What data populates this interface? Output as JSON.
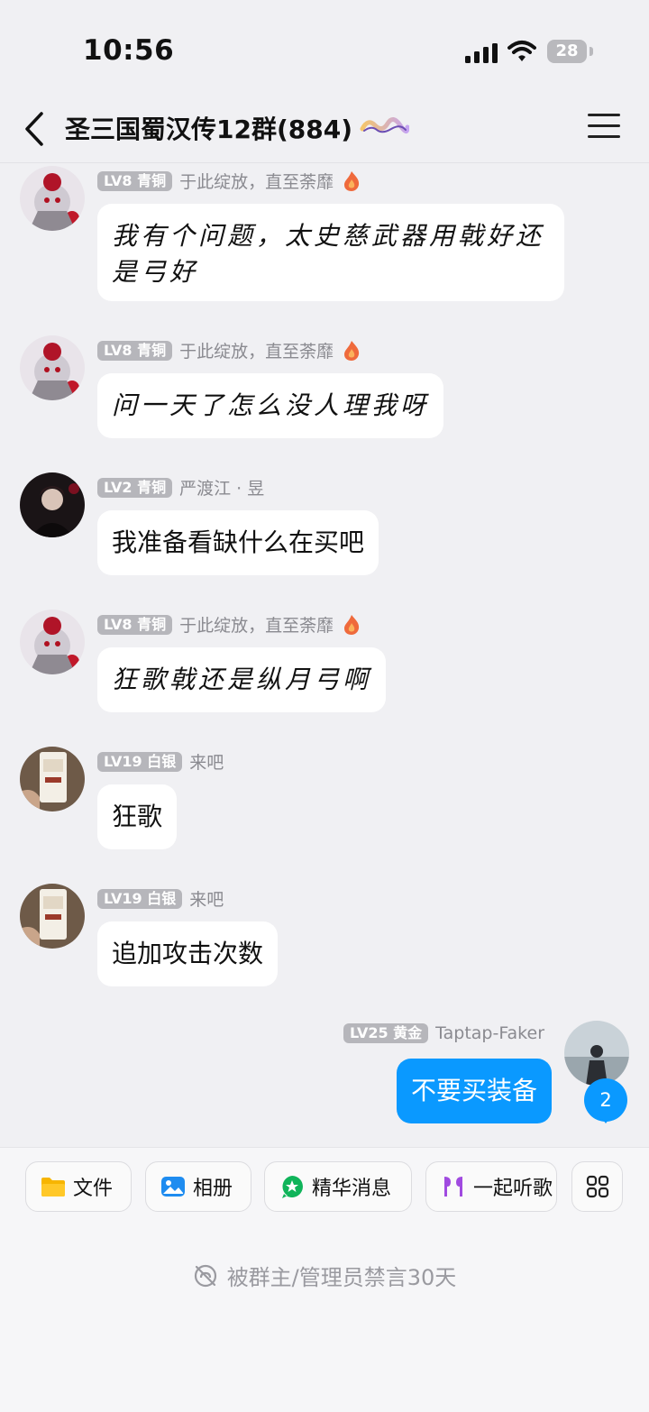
{
  "status": {
    "time": "10:56",
    "battery": "28"
  },
  "header": {
    "title": "圣三国蜀汉传12群(884)",
    "badge_icon": "group-badge-icon"
  },
  "messages": [
    {
      "level": "LV8 青铜",
      "name": "于此绽放，直至荼靡",
      "text": "我有个问题，太史慈武器用戟好还是弓好",
      "style": "handwritten"
    },
    {
      "level": "LV8 青铜",
      "name": "于此绽放，直至荼靡",
      "text": "问一天了怎么没人理我呀",
      "style": "handwritten"
    },
    {
      "level": "LV2 青铜",
      "name": "严渡江 · 昱",
      "text": "我准备看缺什么在买吧",
      "style": "normal"
    },
    {
      "level": "LV8 青铜",
      "name": "于此绽放，直至荼靡",
      "text": "狂歌戟还是纵月弓啊",
      "style": "handwritten"
    },
    {
      "level": "LV19 白银",
      "name": "来吧",
      "text": "狂歌",
      "style": "normal"
    },
    {
      "level": "LV19 白银",
      "name": "来吧",
      "text": "追加攻击次数",
      "style": "normal"
    },
    {
      "level": "LV25 黄金",
      "name": "Taptap-Faker",
      "text": "不要买装备",
      "style": "self"
    }
  ],
  "unread_count": "2",
  "tools": [
    {
      "label": "文件",
      "icon": "folder-icon",
      "color": "#f7b500"
    },
    {
      "label": "相册",
      "icon": "photo-icon",
      "color": "#1e8cf0"
    },
    {
      "label": "精华消息",
      "icon": "star-chat-icon",
      "color": "#10b45a"
    },
    {
      "label": "一起听歌",
      "icon": "earbuds-icon",
      "color": "#a04ae0"
    }
  ],
  "mute_notice": "被群主/管理员禁言30天",
  "colors": {
    "accent": "#0a99ff",
    "background": "#f0f0f3"
  }
}
